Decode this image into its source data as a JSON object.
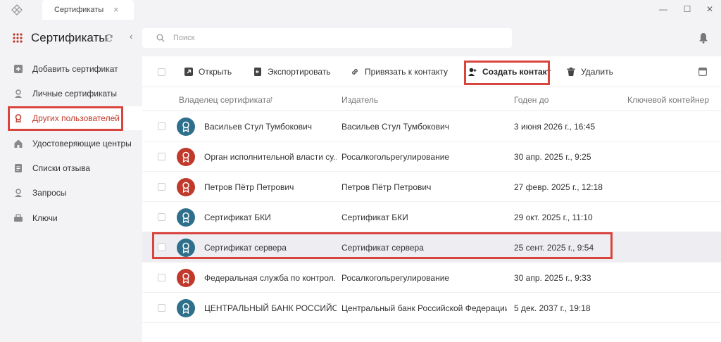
{
  "titlebar": {
    "tab_label": "Сертификаты",
    "close_glyph": "×",
    "minimize_glyph": "—",
    "maximize_glyph": "☐",
    "close_window_glyph": "✕"
  },
  "sidebar": {
    "title": "Сертификаты",
    "collapse_glyph": "‹",
    "items": [
      {
        "label": "Добавить сертификат",
        "icon": "plus-square-icon"
      },
      {
        "label": "Личные сертификаты",
        "icon": "person-icon"
      },
      {
        "label": "Других пользователей",
        "icon": "medal-icon",
        "active": true
      },
      {
        "label": "Удостоверяющие центры",
        "icon": "home-icon"
      },
      {
        "label": "Списки отзыва",
        "icon": "list-file-icon"
      },
      {
        "label": "Запросы",
        "icon": "person-question-icon"
      },
      {
        "label": "Ключи",
        "icon": "key-icon"
      }
    ]
  },
  "search": {
    "placeholder": "Поиск",
    "value": ""
  },
  "toolbar": {
    "open_label": "Открыть",
    "export_label": "Экспортировать",
    "link_label": "Привязать к контакту",
    "create_contact_label": "Создать контакт",
    "delete_label": "Удалить"
  },
  "table": {
    "columns": {
      "owner": "Владелец сертификата",
      "sort_glyph": "↑",
      "issuer": "Издатель",
      "valid_until": "Годен до",
      "key_container": "Ключевой контейнер"
    },
    "rows": [
      {
        "owner": "Васильев Стул Тумбокович",
        "issuer": "Васильев Стул Тумбокович",
        "valid_until": "3 июня 2026 г., 16:45",
        "key_container": "",
        "icon_color": "#2e6f8c"
      },
      {
        "owner": "Орган исполнительной власти су...",
        "issuer": "Росалкогольрегулирование",
        "valid_until": "30 апр. 2025 г., 9:25",
        "key_container": "",
        "icon_color": "#c0392b"
      },
      {
        "owner": "Петров Пётр Петрович",
        "issuer": "Петров Пётр Петрович",
        "valid_until": "27 февр. 2025 г., 12:18",
        "key_container": "",
        "icon_color": "#c0392b"
      },
      {
        "owner": "Сертификат БКИ",
        "issuer": "Сертификат БКИ",
        "valid_until": "29 окт. 2025 г., 11:10",
        "key_container": "",
        "icon_color": "#2e6f8c"
      },
      {
        "owner": "Сертификат сервера",
        "issuer": "Сертификат сервера",
        "valid_until": "25 сент. 2025 г., 9:54",
        "key_container": "",
        "icon_color": "#2e6f8c",
        "selected": true
      },
      {
        "owner": "Федеральная служба по контрол...",
        "issuer": "Росалкогольрегулирование",
        "valid_until": "30 апр. 2025 г., 9:33",
        "key_container": "",
        "icon_color": "#c0392b"
      },
      {
        "owner": "ЦЕНТРАЛЬНЫЙ БАНК РОССИЙС...",
        "issuer": "Центральный банк Российской Федерации",
        "valid_until": "5 дек. 2037 г., 19:18",
        "key_container": "",
        "icon_color": "#2e6f8c"
      }
    ]
  },
  "colors": {
    "accent_red": "#c0392b",
    "accent_teal": "#2e6f8c",
    "highlight_box": "#d8453e"
  }
}
